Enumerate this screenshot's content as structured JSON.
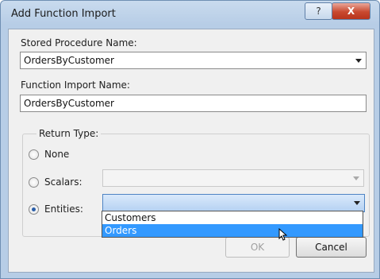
{
  "window": {
    "title": "Add Function Import",
    "help_glyph": "?",
    "close_glyph": "X"
  },
  "stored_procedure": {
    "label": "Stored Procedure Name:",
    "value": "OrdersByCustomer"
  },
  "function_import": {
    "label": "Function Import Name:",
    "value": "OrdersByCustomer"
  },
  "return_type": {
    "label": "Return Type:",
    "options": [
      {
        "label": "None",
        "selected": false
      },
      {
        "label": "Scalars:",
        "selected": false
      },
      {
        "label": "Entities:",
        "selected": true
      }
    ],
    "scalars_value": "",
    "entities_value": "",
    "entities_dropdown": [
      "Customers",
      "Orders"
    ],
    "highlighted": "Orders"
  },
  "buttons": {
    "ok": "OK",
    "cancel": "Cancel"
  }
}
